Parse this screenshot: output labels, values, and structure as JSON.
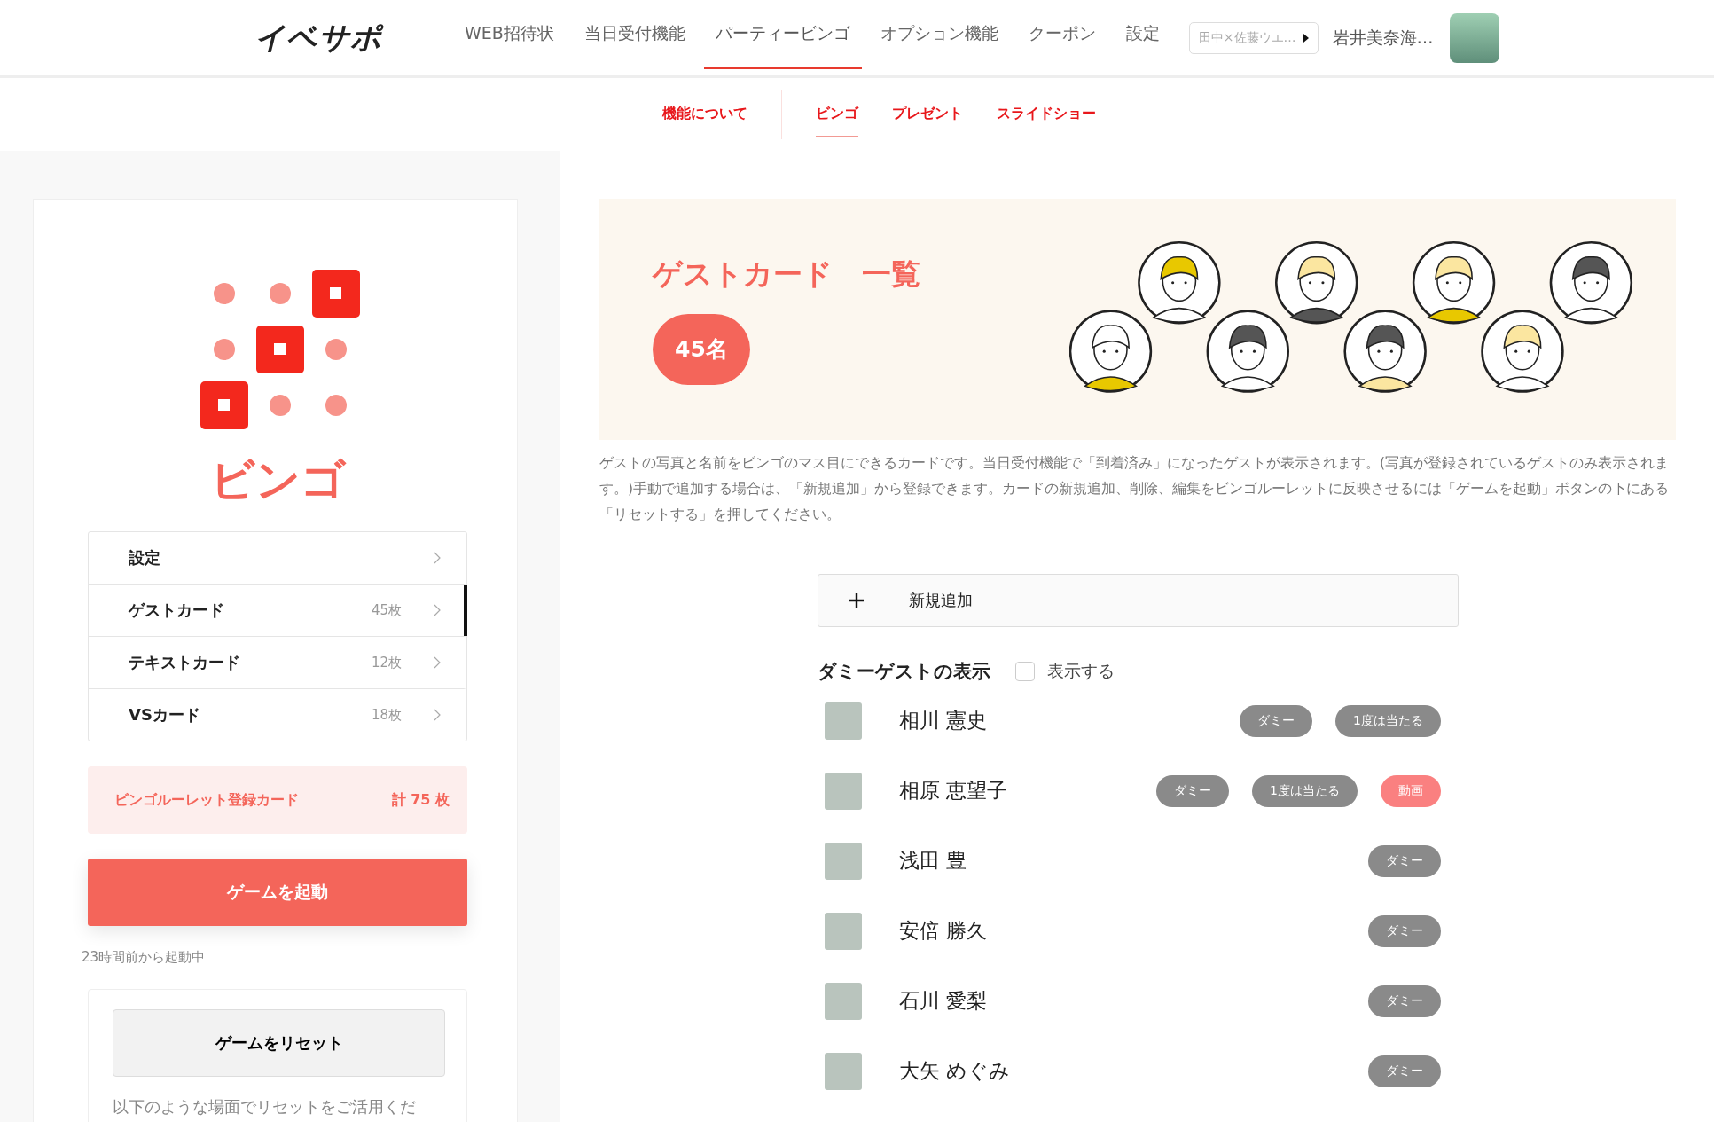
{
  "header": {
    "logo": "イベサポ",
    "nav": [
      {
        "label": "WEB招待状",
        "selected": false
      },
      {
        "label": "当日受付機能",
        "selected": false
      },
      {
        "label": "パーティービンゴ",
        "selected": true
      },
      {
        "label": "オプション機能",
        "selected": false
      },
      {
        "label": "クーポン",
        "selected": false
      },
      {
        "label": "設定",
        "selected": false
      }
    ],
    "event_select": "田中×佐藤ウエ…",
    "user_name": "岩井美奈海…"
  },
  "subnav": [
    {
      "label": "機能について",
      "selected": false
    },
    {
      "label": "ビンゴ",
      "selected": true
    },
    {
      "label": "プレゼント",
      "selected": false
    },
    {
      "label": "スライドショー",
      "selected": false
    }
  ],
  "sidebar": {
    "title": "ビンゴ",
    "menu": [
      {
        "label": "設定",
        "selected": false
      },
      {
        "label": "ゲストカード",
        "count": "45枚",
        "selected": true
      },
      {
        "label": "テキストカード",
        "count": "12枚",
        "selected": false
      },
      {
        "label": "VSカード",
        "count": "18枚",
        "selected": false
      }
    ],
    "total_label": "ビンゴルーレット登録カード",
    "total_value": "計 75 枚",
    "start_button": "ゲームを起動",
    "running_note": "23時間前から起動中",
    "reset_button": "ゲームをリセット",
    "reset_note": "以下のような場面でリセットをご活用くだ"
  },
  "main": {
    "title": "ゲストカード　一覧",
    "count_badge": "45名",
    "description": "ゲストの写真と名前をビンゴのマス目にできるカードです。当日受付機能で「到着済み」になったゲストが表示されます。(写真が登録されているゲストのみ表示されます。)手動で追加する場合は、「新規追加」から登録できます。カードの新規追加、削除、編集をビンゴルーレットに反映させるには「ゲームを起動」ボタンの下にある「リセットする」を押してください。",
    "add_button": "新規追加",
    "dummy_label": "ダミーゲストの表示",
    "dummy_toggle": {
      "label": "表示する",
      "checked": false
    },
    "guests": [
      {
        "name": "相川 憲史",
        "tags": [
          {
            "kind": "dummy",
            "label": "ダミー"
          },
          {
            "kind": "once",
            "label": "1度は当たる"
          }
        ]
      },
      {
        "name": "相原 恵望子",
        "tags": [
          {
            "kind": "dummy",
            "label": "ダミー"
          },
          {
            "kind": "once",
            "label": "1度は当たる"
          },
          {
            "kind": "video",
            "label": "動画"
          }
        ]
      },
      {
        "name": "浅田 豊",
        "tags": [
          {
            "kind": "dummy",
            "label": "ダミー"
          }
        ]
      },
      {
        "name": "安倍 勝久",
        "tags": [
          {
            "kind": "dummy",
            "label": "ダミー"
          }
        ]
      },
      {
        "name": "石川 愛梨",
        "tags": [
          {
            "kind": "dummy",
            "label": "ダミー"
          }
        ]
      },
      {
        "name": "大矢 めぐみ",
        "tags": [
          {
            "kind": "dummy",
            "label": "ダミー"
          }
        ]
      }
    ]
  }
}
